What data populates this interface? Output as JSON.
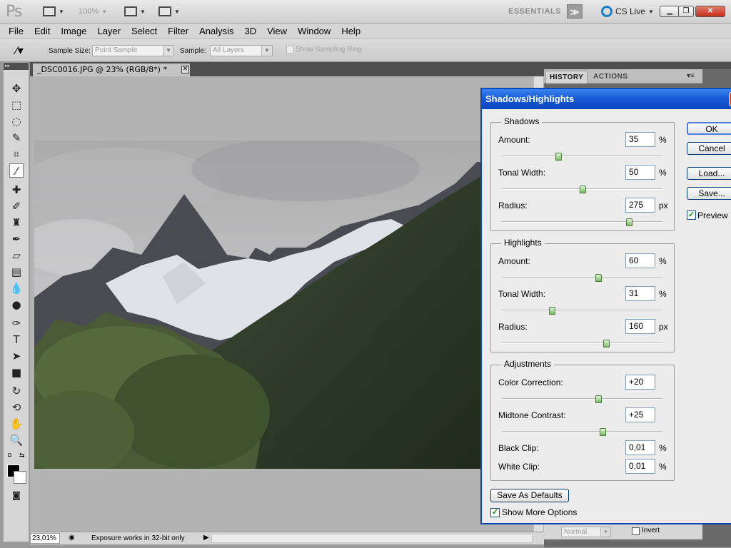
{
  "appbar": {
    "logo": "Ps",
    "zoom_level": "100%",
    "workspace": "ESSENTIALS",
    "cs_live": "CS Live"
  },
  "menu": [
    "File",
    "Edit",
    "Image",
    "Layer",
    "Select",
    "Filter",
    "Analysis",
    "3D",
    "View",
    "Window",
    "Help"
  ],
  "options": {
    "sample_size_label": "Sample Size:",
    "sample_size_value": "Point Sample",
    "sample_label": "Sample:",
    "sample_value": "All Layers",
    "sampling_ring_label": "Show Sampling Ring"
  },
  "document": {
    "tab_title": "_DSC0016.JPG @ 23% (RGB/8*) *"
  },
  "status": {
    "zoom": "23,01%",
    "info": "Exposure works in 32-bit only"
  },
  "panels": {
    "tabs": [
      "HISTORY",
      "ACTIONS"
    ],
    "active_tab": "HISTORY",
    "blend_mode": "Normal",
    "invert_label": "Invert"
  },
  "dialog": {
    "title": "Shadows/Highlights",
    "shadows": {
      "title": "Shadows",
      "amount": {
        "label": "Amount:",
        "value": "35",
        "unit": "%",
        "slider": 0.35
      },
      "tonal_width": {
        "label": "Tonal Width:",
        "value": "50",
        "unit": "%",
        "slider": 0.5
      },
      "radius": {
        "label": "Radius:",
        "value": "275",
        "unit": "px",
        "slider": 0.79
      }
    },
    "highlights": {
      "title": "Highlights",
      "amount": {
        "label": "Amount:",
        "value": "60",
        "unit": "%",
        "slider": 0.6
      },
      "tonal_width": {
        "label": "Tonal Width:",
        "value": "31",
        "unit": "%",
        "slider": 0.31
      },
      "radius": {
        "label": "Radius:",
        "value": "160",
        "unit": "px",
        "slider": 0.65
      }
    },
    "adjustments": {
      "title": "Adjustments",
      "color_correction": {
        "label": "Color Correction:",
        "value": "+20",
        "slider": 0.6
      },
      "midtone_contrast": {
        "label": "Midtone Contrast:",
        "value": "+25",
        "slider": 0.625
      },
      "black_clip": {
        "label": "Black Clip:",
        "value": "0,01",
        "unit": "%"
      },
      "white_clip": {
        "label": "White Clip:",
        "value": "0,01",
        "unit": "%"
      }
    },
    "buttons": {
      "ok": "OK",
      "cancel": "Cancel",
      "load": "Load...",
      "save": "Save...",
      "save_defaults": "Save As Defaults"
    },
    "preview_label": "Preview",
    "preview_checked": true,
    "more_options_label": "Show More Options",
    "more_options_checked": true
  }
}
